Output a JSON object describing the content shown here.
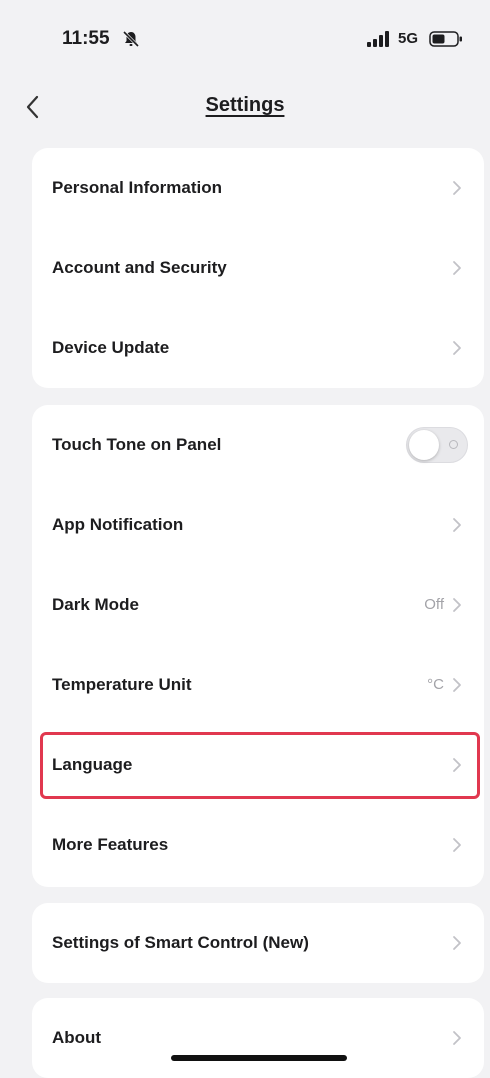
{
  "status_bar": {
    "time": "11:55",
    "network": "5G",
    "icons": [
      "bell-slash-icon",
      "signal-icon",
      "battery-icon"
    ]
  },
  "nav": {
    "title": "Settings",
    "back_icon": "chevron-left-icon"
  },
  "groups": [
    {
      "items": [
        {
          "label": "Personal Information"
        },
        {
          "label": "Account and Security"
        },
        {
          "label": "Device Update"
        }
      ]
    },
    {
      "items": [
        {
          "label": "Touch Tone on Panel",
          "type": "toggle",
          "state": "off"
        },
        {
          "label": "App Notification"
        },
        {
          "label": "Dark Mode",
          "value": "Off"
        },
        {
          "label": "Temperature Unit",
          "value": "°C"
        },
        {
          "label": "Language",
          "highlighted": true
        },
        {
          "label": "More Features"
        }
      ]
    },
    {
      "items": [
        {
          "label": "Settings of Smart Control (New)"
        }
      ]
    },
    {
      "items": [
        {
          "label": "About"
        }
      ]
    }
  ],
  "colors": {
    "background": "#f2f2f4",
    "card": "#ffffff",
    "highlight_border": "#e1384f",
    "value_text": "#a3a3a8"
  }
}
